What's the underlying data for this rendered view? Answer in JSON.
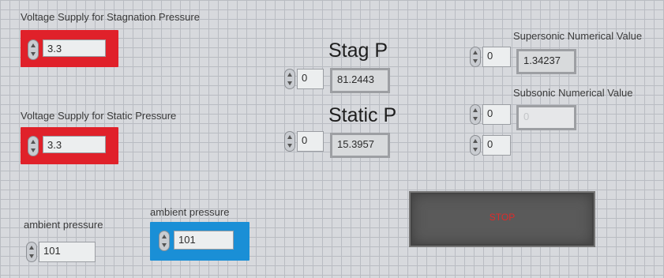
{
  "stagnation": {
    "label": "Voltage Supply for Stagnation Pressure",
    "value": "3.3"
  },
  "static": {
    "label": "Voltage Supply for Static Pressure",
    "value": "3.3"
  },
  "stag_p": {
    "title": "Stag P",
    "index": "0",
    "value": "81.2443"
  },
  "static_p": {
    "title": "Static P",
    "index": "0",
    "value": "15.3957"
  },
  "supersonic": {
    "label": "Supersonic Numerical Value",
    "index": "0",
    "value": "1.34237"
  },
  "subsonic": {
    "label": "Subsonic Numerical Value",
    "index": "0",
    "value": "0",
    "index2": "0"
  },
  "ambient_left": {
    "label": "ambient pressure",
    "value": "101"
  },
  "ambient_right": {
    "label": "ambient pressure",
    "value": "101"
  },
  "stop": {
    "label": "STOP"
  },
  "colors": {
    "red_panel": "#e0212a",
    "blue_panel": "#1a8fd6",
    "stop_text": "#e02a2a"
  }
}
